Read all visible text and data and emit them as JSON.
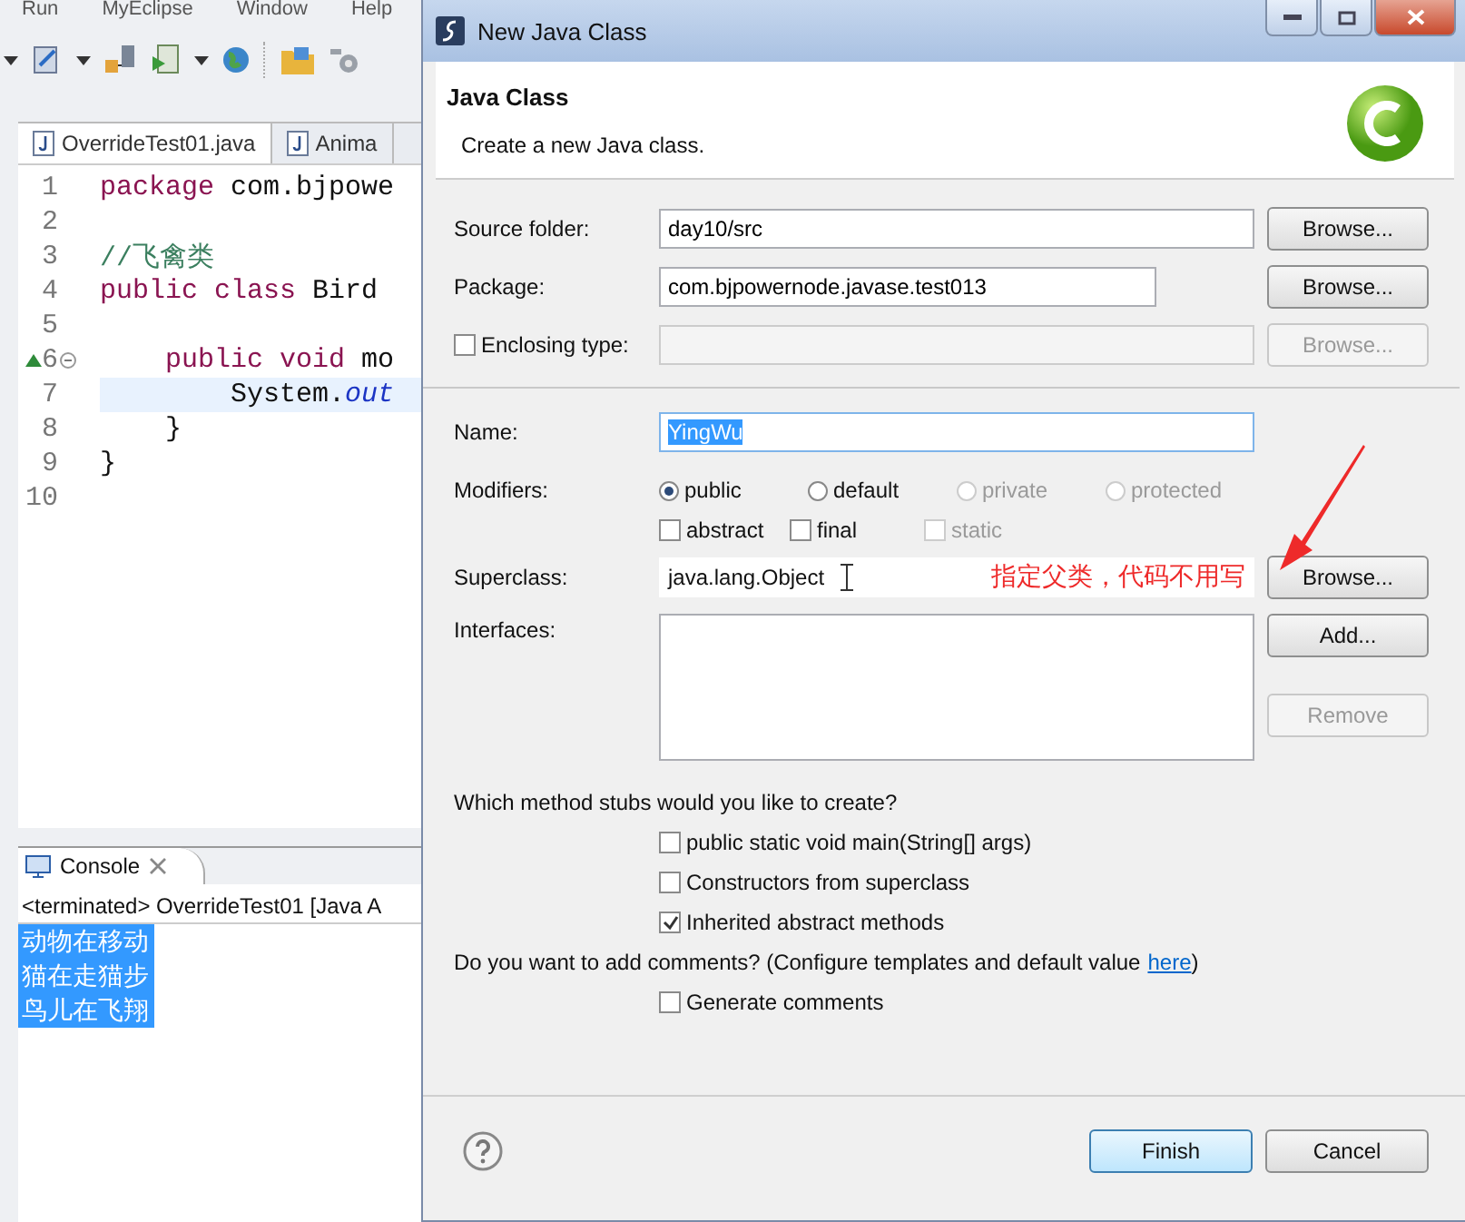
{
  "ide": {
    "menu": [
      "Run",
      "MyEclipse",
      "Window",
      "Help"
    ],
    "editor_tabs": [
      {
        "label": "OverrideTest01.java",
        "selected": true
      },
      {
        "label": "Anima",
        "selected": false
      }
    ],
    "code_lines": [
      {
        "number": "1",
        "segments": [
          {
            "kind": "keyword",
            "text": "package"
          },
          {
            "kind": "plain",
            "text": " com.bjpowe"
          }
        ]
      },
      {
        "number": "2"
      },
      {
        "number": "3",
        "segments": [
          {
            "kind": "comment",
            "text": "//飞禽类"
          }
        ]
      },
      {
        "number": "4",
        "segments": [
          {
            "kind": "keyword",
            "text": "public class"
          },
          {
            "kind": "plain",
            "text": " Bird"
          }
        ]
      },
      {
        "number": "5"
      },
      {
        "number": "6",
        "override": true,
        "foldable": true,
        "segments": [
          {
            "kind": "keyword",
            "text": "    public void"
          },
          {
            "kind": "plain",
            "text": " mo"
          }
        ]
      },
      {
        "number": "7",
        "current": true,
        "segments": [
          {
            "kind": "plain",
            "text": "        System."
          },
          {
            "kind": "field",
            "text": "out"
          }
        ]
      },
      {
        "number": "8",
        "segments": [
          {
            "kind": "plain",
            "text": "    }"
          }
        ]
      },
      {
        "number": "9",
        "segments": [
          {
            "kind": "plain",
            "text": "}"
          }
        ]
      },
      {
        "number": "10"
      }
    ],
    "console": {
      "tab": "Console",
      "status": "<terminated> OverrideTest01 [Java A",
      "output": [
        {
          "text": "动物在移动",
          "selected": true
        },
        {
          "text": "猫在走猫步",
          "selected": true
        },
        {
          "text": "鸟儿在飞翔",
          "selected": true
        }
      ]
    }
  },
  "dialog": {
    "title": "New Java Class",
    "heading": "Java Class",
    "description": "Create a new Java class.",
    "source_folder": {
      "label": "Source folder:",
      "value": "day10/src",
      "button": "Browse..."
    },
    "package": {
      "label": "Package:",
      "value": "com.bjpowernode.javase.test013",
      "button": "Browse..."
    },
    "enclosing_type": {
      "label": "Enclosing type:",
      "checked": false,
      "button": "Browse...",
      "disabled": true
    },
    "name": {
      "label": "Name:",
      "value": "YingWu"
    },
    "modifiers": {
      "label": "Modifiers:",
      "radios": [
        {
          "label": "public",
          "selected": true,
          "disabled": false
        },
        {
          "label": "default",
          "selected": false,
          "disabled": false
        },
        {
          "label": "private",
          "selected": false,
          "disabled": true
        },
        {
          "label": "protected",
          "selected": false,
          "disabled": true
        }
      ],
      "checkboxes": [
        {
          "label": "abstract",
          "checked": false,
          "disabled": false
        },
        {
          "label": "final",
          "checked": false,
          "disabled": false
        },
        {
          "label": "static",
          "checked": false,
          "disabled": true
        }
      ]
    },
    "superclass": {
      "label": "Superclass:",
      "value": "java.lang.Object",
      "annotation": "指定父类，代码不用写",
      "button": "Browse..."
    },
    "interfaces": {
      "label": "Interfaces:",
      "buttons": [
        {
          "label": "Add...",
          "disabled": false
        },
        {
          "label": "Remove",
          "disabled": true
        }
      ]
    },
    "stubs": {
      "question": "Which method stubs would you like to create?",
      "options": [
        {
          "label": "public static void main(String[] args)",
          "checked": false
        },
        {
          "label": "Constructors from superclass",
          "checked": false
        },
        {
          "label": "Inherited abstract methods",
          "checked": true
        }
      ]
    },
    "comments": {
      "question": "Do you want to add comments? (Configure templates and default value",
      "link": "here",
      "question_end": ")",
      "options": [
        {
          "label": "Generate comments",
          "checked": false
        }
      ]
    },
    "buttons": [
      {
        "label": "Finish",
        "default": true
      },
      {
        "label": "Cancel",
        "default": false
      }
    ]
  }
}
